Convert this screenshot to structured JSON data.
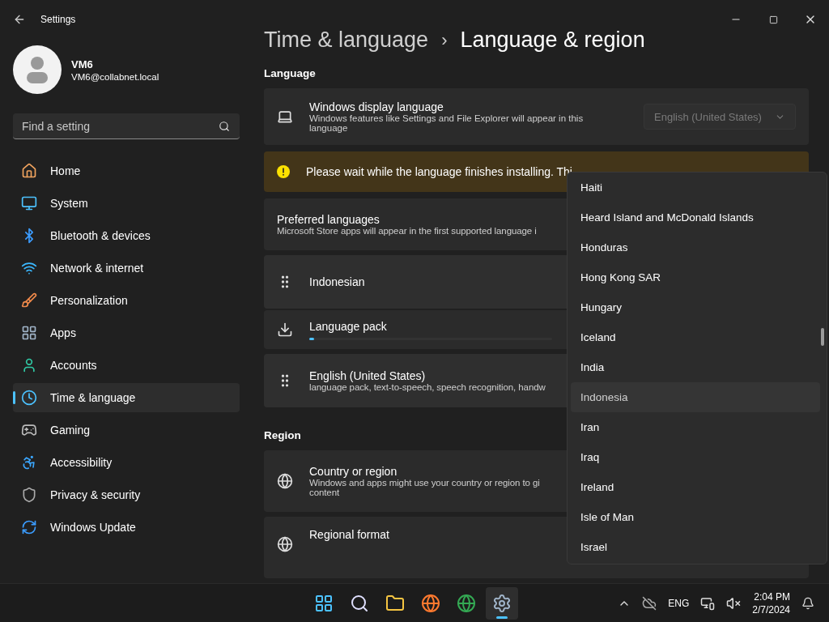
{
  "window": {
    "title": "Settings"
  },
  "profile": {
    "name": "VM6",
    "email": "VM6@collabnet.local"
  },
  "search": {
    "placeholder": "Find a setting"
  },
  "sidebar": {
    "items": [
      {
        "label": "Home",
        "selected": false
      },
      {
        "label": "System",
        "selected": false
      },
      {
        "label": "Bluetooth & devices",
        "selected": false
      },
      {
        "label": "Network & internet",
        "selected": false
      },
      {
        "label": "Personalization",
        "selected": false
      },
      {
        "label": "Apps",
        "selected": false
      },
      {
        "label": "Accounts",
        "selected": false
      },
      {
        "label": "Time & language",
        "selected": true
      },
      {
        "label": "Gaming",
        "selected": false
      },
      {
        "label": "Accessibility",
        "selected": false
      },
      {
        "label": "Privacy & security",
        "selected": false
      },
      {
        "label": "Windows Update",
        "selected": false
      }
    ]
  },
  "breadcrumb": {
    "parent": "Time & language",
    "separator": "›",
    "current": "Language & region"
  },
  "language": {
    "heading": "Language",
    "display_language": {
      "title": "Windows display language",
      "description": "Windows features like Settings and File Explorer will appear in this language",
      "value": "English (United States)",
      "disabled": true
    },
    "warning": "Please wait while the language finishes installing. Thi",
    "preferred": {
      "title": "Preferred languages",
      "description": "Microsoft Store apps will appear in the first supported language i"
    },
    "languages": [
      {
        "name": "Indonesian",
        "pack": {
          "label": "Language pack",
          "level": 0.02
        }
      },
      {
        "name": "English (United States)",
        "description": "language pack, text-to-speech, speech recognition, handw"
      }
    ]
  },
  "region": {
    "heading": "Region",
    "country": {
      "title": "Country or region",
      "description": "Windows and apps might use your country or region to gi",
      "description_2": "content"
    },
    "format": {
      "title": "Regional format"
    }
  },
  "country_dropdown": {
    "items": [
      {
        "label": "Haiti",
        "highlighted": false
      },
      {
        "label": "Heard Island and McDonald Islands",
        "highlighted": false
      },
      {
        "label": "Honduras",
        "highlighted": false
      },
      {
        "label": "Hong Kong SAR",
        "highlighted": false
      },
      {
        "label": "Hungary",
        "highlighted": false
      },
      {
        "label": "Iceland",
        "highlighted": false
      },
      {
        "label": "India",
        "highlighted": false
      },
      {
        "label": "Indonesia",
        "highlighted": true
      },
      {
        "label": "Iran",
        "highlighted": false
      },
      {
        "label": "Iraq",
        "highlighted": false
      },
      {
        "label": "Ireland",
        "highlighted": false
      },
      {
        "label": "Isle of Man",
        "highlighted": false
      },
      {
        "label": "Israel",
        "highlighted": false
      }
    ]
  },
  "taskbar": {
    "apps": [
      {
        "selected": false
      },
      {
        "selected": false
      },
      {
        "selected": false
      },
      {
        "selected": false
      },
      {
        "selected": false
      },
      {
        "selected": true
      }
    ],
    "language": "ENG",
    "time": "2:04 PM",
    "date": "2/7/2024"
  }
}
